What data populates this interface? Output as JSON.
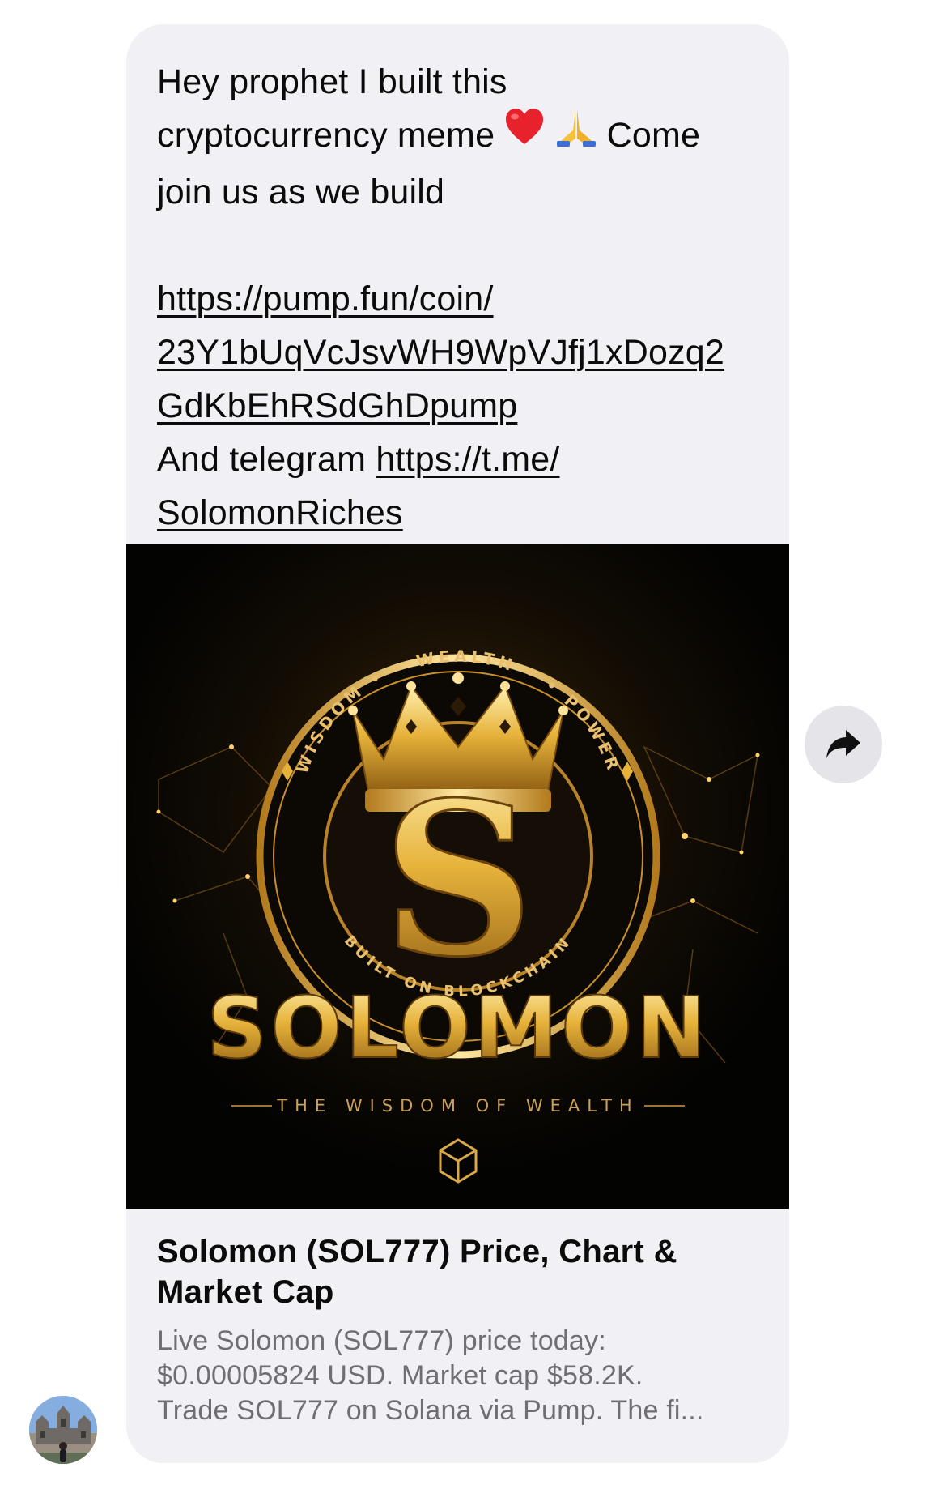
{
  "message": {
    "text_lines": [
      "Hey prophet I built this",
      "join us as we build"
    ],
    "line2_before": "cryptocurrency meme",
    "line2_after": "Come",
    "emoji_heart": "heart-emoji",
    "emoji_pray": "folded-hands-emoji",
    "link1_lines": [
      "https://pump.fun/coin/",
      "23Y1bUqVcJsvWH9WpVJfj1xDozq2",
      "GdKbEhRSdGhDpump"
    ],
    "telegram_prefix": "And telegram ",
    "telegram_link_lines": [
      "https://t.me/",
      "SolomonRiches"
    ]
  },
  "preview": {
    "image": {
      "ring_top_text": "WISDOM • • WEALTH • • POWER",
      "ring_bottom_text": "BUILT ON BLOCKCHAIN",
      "wordmark": "SOLOMON",
      "tagline": "THE WISDOM OF WEALTH",
      "letter": "S"
    },
    "title_lines": [
      "Solomon  (SOL777) Price, Chart &",
      "Market Cap"
    ],
    "description_lines": [
      "Live Solomon  (SOL777) price today:",
      "$0.00005824 USD. Market cap $58.2K.",
      "Trade SOL777 on Solana via Pump. The fi..."
    ]
  },
  "colors": {
    "bubble": "#f0f0f5",
    "gold": "#e6b23a",
    "share_button": "#e4e4e9"
  },
  "icons": {
    "share": "share-arrow-icon",
    "avatar": "sender-avatar"
  }
}
